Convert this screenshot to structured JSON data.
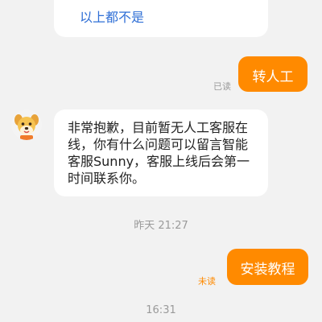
{
  "option_card": {
    "option_label": "以上都不是"
  },
  "messages": {
    "transfer_request": {
      "text": "转人工",
      "status": "已读"
    },
    "bot_reply": {
      "text": "非常抱歉，目前暂无人工客服在线，你有什么问题可以留言智能客服Sunny，客服上线后会第一时间联系你。",
      "avatar_icon": "dog-mascot-icon"
    },
    "timestamp_1": "昨天 21:27",
    "tutorial_request": {
      "text": "安装教程",
      "status": "未读"
    },
    "timestamp_2": "16:31"
  },
  "colors": {
    "accent": "#ff8a00",
    "link": "#2f6fd6",
    "background": "#f2f2f2"
  }
}
